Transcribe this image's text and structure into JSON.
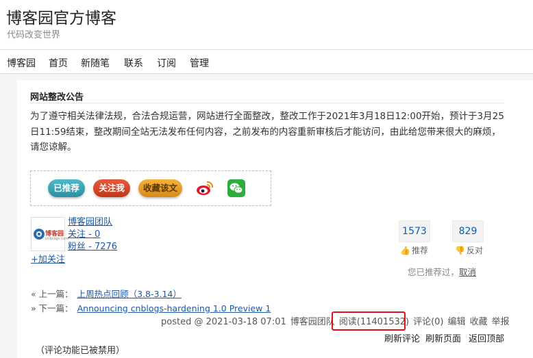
{
  "site": {
    "title": "博客园官方博客",
    "subtitle": "代码改变世界"
  },
  "nav": [
    "博客园",
    "首页",
    "新随笔",
    "联系",
    "订阅",
    "管理"
  ],
  "notice": {
    "title": "网站整改公告",
    "body": "为了遵守相关法律法规，合法合规运营，网站进行全面整改，整改工作于2021年3月18日12:00开始，预计于3月25日11:59结束，整改期间全站无法发布任何内容，之前发布的内容重新审核后才能访问，由此给您带来很大的麻烦，请您谅解。"
  },
  "share": {
    "recommend": "已推荐",
    "follow": "关注我",
    "collect": "收藏该文",
    "weibo_icon": "weibo-icon",
    "wechat_icon": "wechat-icon"
  },
  "author": {
    "avatar_text": "博客园",
    "avatar_sub": "cnblogs.com",
    "name": "博客园团队",
    "following": "关注 - 0",
    "fans": "粉丝 - 7276",
    "add_follow": "+加关注"
  },
  "votes": {
    "up_count": "1573",
    "up_label": "推荐",
    "down_count": "829",
    "down_label": "反对",
    "voted_msg": "您已推荐过，",
    "cancel": "取消"
  },
  "prev": {
    "label": "« 上一篇：",
    "title": "上周热点回顾（3.8-3.14）"
  },
  "next": {
    "label": "» 下一篇：",
    "title": "Announcing cnblogs-hardening 1.0 Preview 1"
  },
  "post_info": {
    "posted": "posted @ 2021-03-18 07:01",
    "author": "博客园团队",
    "reads": "阅读(11401532)",
    "comments": "评论(0)",
    "edit": "编辑",
    "collect": "收藏",
    "report": "举报"
  },
  "footer": {
    "refresh_comments": "刷新评论",
    "refresh_page": "刷新页面",
    "back_top": "返回顶部"
  },
  "comment_disabled": "（评论功能已被禁用）",
  "colors": {
    "link": "#1d58a8",
    "highlight": "#e0101b"
  }
}
